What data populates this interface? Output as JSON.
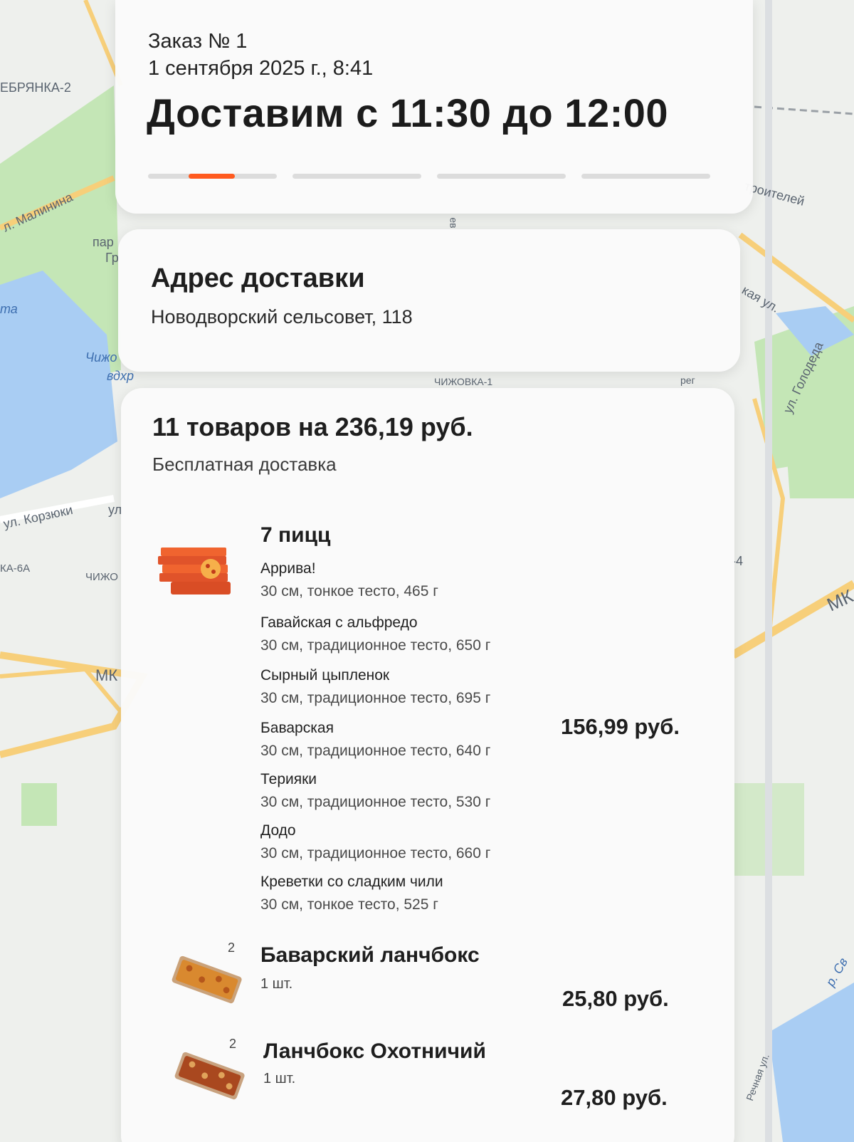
{
  "map": {
    "labels": [
      "ЕБРЯНКА-2",
      "л. Малинина",
      "пар",
      "Гр",
      "та",
      "Чижо",
      "вдхр",
      "ул. Корзюки",
      "ул",
      "КА-6А",
      "ЧИЖО",
      "МК",
      "троителей",
      "кая ул.",
      "ул. Голодеда",
      "-4",
      "МК",
      "р. Св",
      "Речная ул.",
      "ев",
      "ЧИЖОВКА-1",
      "рег"
    ]
  },
  "order": {
    "number": "Заказ № 1",
    "datetime": "1 сентября 2025 г., 8:41",
    "delivery_window": "Доставим с 11:30 до 12:00",
    "progress": [
      0.45,
      0,
      0,
      0
    ]
  },
  "address": {
    "title": "Адрес доставки",
    "value": "Новодворский сельсовет, 118"
  },
  "cart": {
    "summary": "11 товаров на 236,19 руб.",
    "delivery_note": "Бесплатная доставка",
    "pizza_group": {
      "name": "7 пицц",
      "price": "156,99 руб.",
      "items": [
        {
          "name": "Аррива!",
          "desc": "30 см, тонкое тесто, 465 г"
        },
        {
          "name": "Гавайская с альфредо",
          "desc": "30 см, традиционное тесто, 650 г"
        },
        {
          "name": "Сырный цыпленок",
          "desc": "30 см, традиционное тесто, 695 г"
        },
        {
          "name": "Баварская",
          "desc": "30 см, традиционное тесто, 640 г"
        },
        {
          "name": "Терияки",
          "desc": "30 см, традиционное тесто, 530 г"
        },
        {
          "name": "Додо",
          "desc": "30 см, традиционное тесто, 660 г"
        },
        {
          "name": "Креветки со сладким чили",
          "desc": "30 см, тонкое тесто, 525 г"
        }
      ]
    },
    "lunchbox_1": {
      "badge": "2",
      "name": "Баварский ланчбокс",
      "unit": "1 шт.",
      "price": "25,80 руб."
    },
    "lunchbox_2": {
      "badge": "2",
      "name": "Ланчбокс Охотничий",
      "unit": "1 шт.",
      "price": "27,80 руб."
    }
  },
  "colors": {
    "accent": "#ff5a1f",
    "card": "#fafafa",
    "map_water": "#a9cdf3",
    "map_green": "#bfe3b2",
    "map_road": "#f7cf7a"
  }
}
